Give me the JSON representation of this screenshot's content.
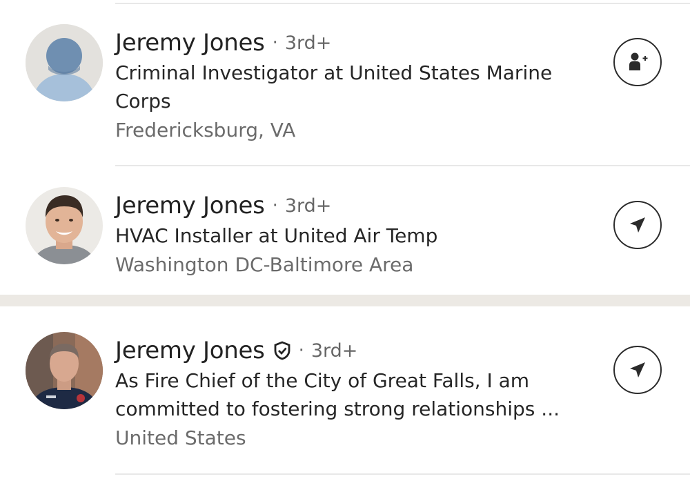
{
  "results": [
    {
      "name": "Jeremy Jones",
      "separator": "·",
      "degree": "3rd+",
      "headline": "Criminal Investigator at United States Marine Corps",
      "location": "Fredericksburg, VA",
      "avatar": "default-avatar-placeholder",
      "action_icon": "connect-person-plus-icon",
      "verified": false
    },
    {
      "name": "Jeremy Jones",
      "separator": "·",
      "degree": "3rd+",
      "headline": "HVAC Installer at United Air Temp",
      "location": "Washington DC-Baltimore Area",
      "avatar": "profile-photo",
      "action_icon": "send-message-icon",
      "verified": false
    },
    {
      "name": "Jeremy Jones",
      "separator": "·",
      "degree": "3rd+",
      "headline": "As Fire Chief of the City of Great Falls, I am committed to fostering strong relationships ...",
      "location": "United States",
      "avatar": "profile-photo",
      "action_icon": "send-message-icon",
      "verified": true
    }
  ],
  "colors": {
    "section_band": "#ece9e4",
    "divider": "#e8e8e8",
    "secondary_text": "#6b6b6b",
    "default_avatar_bg": "#dcdfe3",
    "default_avatar_figure": "#9db7d2"
  }
}
